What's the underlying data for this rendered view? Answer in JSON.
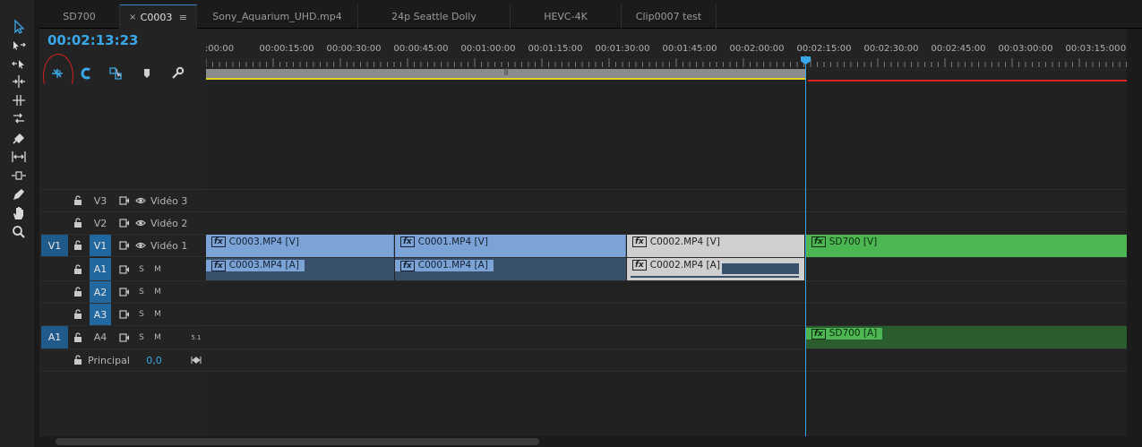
{
  "tabs": [
    {
      "label": "SD700",
      "active": false
    },
    {
      "label": "C0003",
      "active": true
    },
    {
      "label": "Sony_Aquarium_UHD.mp4",
      "active": false
    },
    {
      "label": "24p Seattle Dolly",
      "active": false
    },
    {
      "label": "HEVC-4K",
      "active": false
    },
    {
      "label": "Clip0007 test",
      "active": false
    }
  ],
  "tab_close": "×",
  "tab_menu": "≡",
  "timecode": "00:02:13:23",
  "ruler_labels": [
    ":00:00",
    "00:00:15:00",
    "00:00:30:00",
    "00:00:45:00",
    "00:01:00:00",
    "00:01:15:00",
    "00:01:30:00",
    "00:01:45:00",
    "00:02:00:00",
    "00:02:15:00",
    "00:02:30:00",
    "00:02:45:00",
    "00:03:00:00",
    "00:03:15:00",
    "0"
  ],
  "work_area_handle": "|||",
  "video_tracks": [
    {
      "source": "",
      "name": "V3",
      "label": "Vidéo 3"
    },
    {
      "source": "",
      "name": "V2",
      "label": "Vidéo 2"
    },
    {
      "source": "V1",
      "name": "V1",
      "label": "Vidéo 1"
    }
  ],
  "audio_tracks": [
    {
      "source": "",
      "name": "A1",
      "s": "S",
      "m": "M",
      "extra": ""
    },
    {
      "source": "",
      "name": "A2",
      "s": "S",
      "m": "M",
      "extra": ""
    },
    {
      "source": "",
      "name": "A3",
      "s": "S",
      "m": "M",
      "extra": ""
    },
    {
      "source": "A1",
      "name": "A4",
      "s": "S",
      "m": "M",
      "extra": "5.1"
    }
  ],
  "master": {
    "label": "Principal",
    "value": "0,0"
  },
  "fx_badge": "fx",
  "video_clips": [
    {
      "label": "C0003.MP4 [V]",
      "style": "blue"
    },
    {
      "label": "C0001.MP4 [V]",
      "style": "blue"
    },
    {
      "label": "C0002.MP4 [V]",
      "style": "white"
    },
    {
      "label": "SD700 [V]",
      "style": "green"
    }
  ],
  "audio_clips": [
    {
      "label": "C0003.MP4 [A]",
      "style": "blue"
    },
    {
      "label": "C0001.MP4 [A]",
      "style": "blue"
    },
    {
      "label": "C0002.MP4 [A]",
      "style": "white"
    },
    {
      "label": "SD700 [A]",
      "style": "green"
    }
  ],
  "colors": {
    "accent": "#3aa7e8",
    "video_clip": "#7ba3d6",
    "audio_clip": "#39506d",
    "green_clip": "#4bb652",
    "highlight_circle": "#d02020"
  },
  "tools": [
    "selection-tool-icon",
    "track-select-forward-icon",
    "track-select-backward-icon",
    "ripple-edit-icon",
    "rolling-edit-icon",
    "rate-stretch-icon",
    "razor-icon",
    "slip-icon",
    "slide-icon",
    "pen-icon",
    "hand-icon",
    "zoom-icon"
  ],
  "header_buttons": [
    "nest-sequence-icon",
    "snap-icon",
    "linked-selection-icon",
    "add-marker-icon",
    "timeline-settings-icon"
  ]
}
